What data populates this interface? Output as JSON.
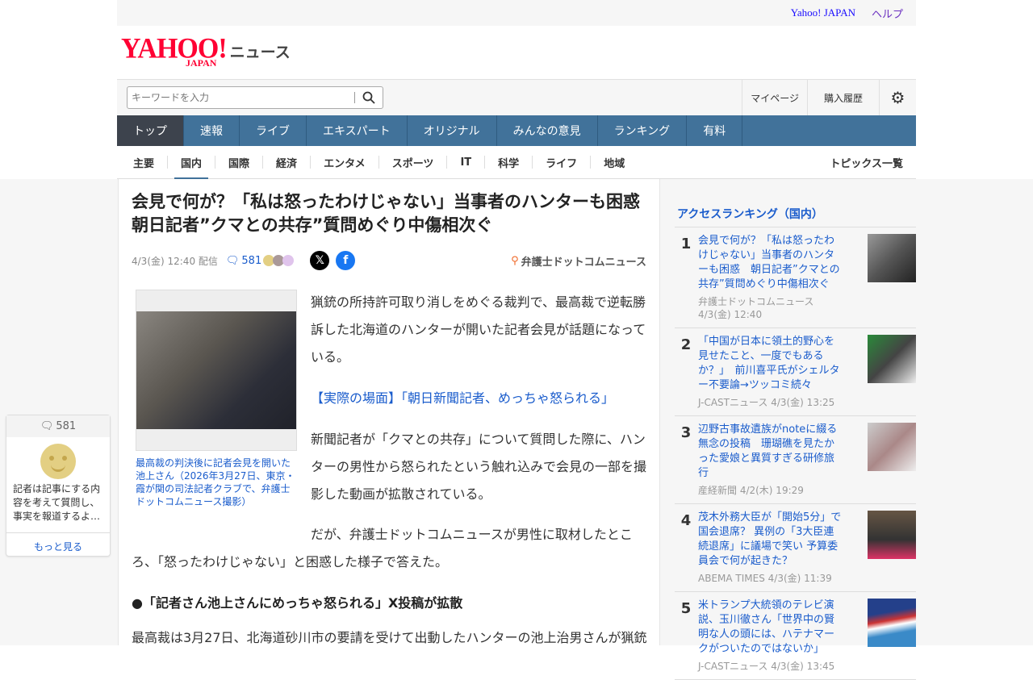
{
  "topbar": {
    "yahoo": "Yahoo! JAPAN",
    "help": "ヘルプ"
  },
  "logo": {
    "brand": "YAHOO!",
    "sub": "JAPAN",
    "service": "ニュース"
  },
  "search": {
    "placeholder": "キーワードを入力"
  },
  "header_links": {
    "mypage": "マイページ",
    "history": "購入履歴"
  },
  "nav": [
    "トップ",
    "速報",
    "ライブ",
    "エキスパート",
    "オリジナル",
    "みんなの意見",
    "ランキング",
    "有料"
  ],
  "subnav": {
    "items": [
      "主要",
      "国内",
      "国際",
      "経済",
      "エンタメ",
      "スポーツ",
      "IT",
      "科学",
      "ライフ",
      "地域"
    ],
    "active": "国内",
    "all": "トピックス一覧"
  },
  "article": {
    "title": "会見で何が？「私は怒ったわけじゃない」当事者のハンターも困惑　朝日記者”クマとの共存”質問めぐり中傷相次ぐ",
    "date": "4/3(金) 12:40 配信",
    "comments": "581",
    "source": "弁護士ドットコムニュース",
    "caption": "最高裁の判決後に記者会見を開いた池上さん（2026年3月27日、東京・霞が関の司法記者クラブで、弁護士ドットコムニュース撮影）",
    "p1": "猟銃の所持許可取り消しをめぐる裁判で、最高裁で逆転勝訴した北海道のハンターが開いた記者会見が話題になっている。",
    "link": "【実際の場面】「朝日新聞記者、めっちゃ怒られる」",
    "p2": "新聞記者が「クマとの共存」について質問した際に、ハンターの男性から怒られたという触れ込みで会見の一部を撮影した動画が拡散されている。",
    "p3": "だが、弁護士ドットコムニュースが男性に取材したところ、「怒ったわけじゃない」と困惑した様子で答えた。",
    "h2": "●「記者さん池上さんにめっちゃ怒られる」X投稿が拡散",
    "p4": "最高裁は3月27日、北海道砂川市の要請を受けて出動したハンターの池上治男さんが猟銃"
  },
  "comment_box": {
    "count": "581",
    "text": "記者は記事にする内容を考えて質問し、事実を報道するよ…",
    "more": "もっと見る"
  },
  "ranking": {
    "title": "アクセスランキング（国内）",
    "items": [
      {
        "rank": "1",
        "title": "会見で何が？「私は怒ったわけじゃない」当事者のハンターも困惑　朝日記者”クマとの共存”質問めぐり中傷相次ぐ",
        "source": "弁護士ドットコムニュース 4/3(金) 12:40"
      },
      {
        "rank": "2",
        "title": "「中国が日本に領土的野心を見せたこと、一度でもあるか？」　前川喜平氏がシェルター不要論→ツッコミ続々",
        "source": "J-CASTニュース 4/3(金) 13:25"
      },
      {
        "rank": "3",
        "title": "辺野古事故遺族がnoteに綴る無念の投稿　珊瑚礁を見たかった愛娘と異質すぎる研修旅行",
        "source": "産経新聞 4/2(木) 19:29"
      },
      {
        "rank": "4",
        "title": "茂木外務大臣が「開始5分」で国会退席？ 異例の「3大臣連続退席」に議場で笑い 予算委員会で何が起きた？",
        "source": "ABEMA TIMES 4/3(金) 11:39"
      },
      {
        "rank": "5",
        "title": "米トランプ大統領のテレビ演説、玉川徹さん「世界中の賢明な人の頭には、ハテナマークがついたのではないか」",
        "source": "J-CASTニュース 4/3(金) 13:45"
      }
    ]
  }
}
